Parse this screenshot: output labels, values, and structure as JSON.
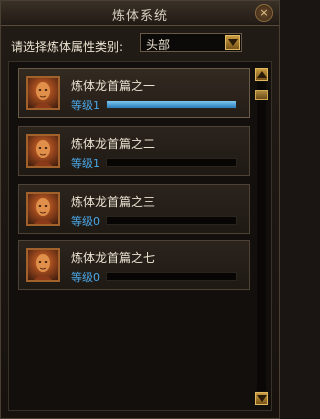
{
  "window": {
    "title": "炼体系统",
    "close_label": "×"
  },
  "filter": {
    "label": "请选择炼体属性类别:",
    "selected": "头部"
  },
  "entries": [
    {
      "name": "炼体龙首篇之一",
      "level": "等级1",
      "progress": 1.0,
      "selected": true
    },
    {
      "name": "炼体龙首篇之二",
      "level": "等级1",
      "progress": 0.0,
      "selected": false
    },
    {
      "name": "炼体龙首篇之三",
      "level": "等级0",
      "progress": 0.0,
      "selected": false
    },
    {
      "name": "炼体龙首篇之七",
      "level": "等级0",
      "progress": 0.0,
      "selected": false
    }
  ],
  "colors": {
    "level_text": "#4aa8e8",
    "bar_fill": "#7ec8f0",
    "accent_gold": "#c89a40"
  },
  "icons": {
    "close": "close-icon",
    "dropdown": "chevron-down-icon",
    "scroll_up": "arrow-up-icon",
    "scroll_down": "arrow-down-icon",
    "portrait": "skill-portrait-icon"
  }
}
